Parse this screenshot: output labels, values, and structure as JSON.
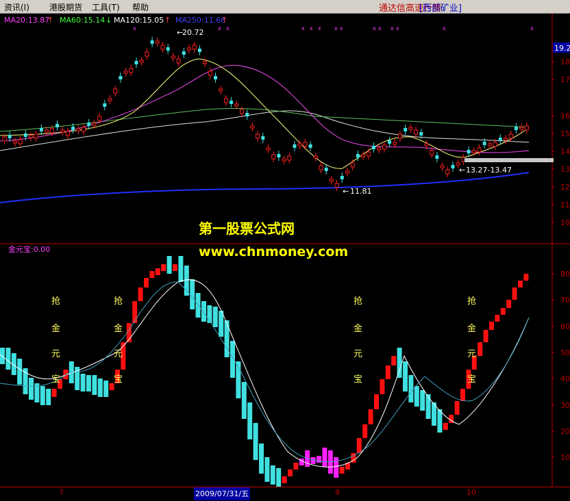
{
  "menu": {
    "items": [
      "资讯(I)",
      "港股期货",
      "工具(T)",
      "帮助"
    ],
    "title": "通达信高速行情",
    "stock": "[西部矿业]"
  },
  "ma_legend": {
    "ma20": "MA20:13.87",
    "ma60": "MA60:15.14",
    "ma120": "MA120:15.05",
    "ma250": "MA250:11.68",
    "colors": {
      "ma20": "#ff40ff",
      "ma60": "#40ff40",
      "ma120": "#ffffff",
      "ma250": "#4040ff"
    }
  },
  "price_panel": {
    "y_ticks": [
      "19.2",
      "18",
      "17",
      "16",
      "15",
      "14",
      "13",
      "12",
      "11",
      "10"
    ],
    "high_label": "20.72",
    "low_label": "11.81",
    "range_label": "13.27-13.47",
    "up_color": "#ff2020",
    "down_color": "#40e0e0"
  },
  "indicator_panel": {
    "title": "金元宝:0.00",
    "y_ticks": [
      "80",
      "70",
      "60",
      "50",
      "40",
      "30",
      "20",
      "10"
    ],
    "signal_chars": [
      "抢",
      "金",
      "元",
      "宝"
    ]
  },
  "watermark": {
    "line1": "第一股票公式网",
    "line2": "www.chnmoney.com"
  },
  "timebar": {
    "ticks": [
      "7",
      "9",
      "10"
    ],
    "date": "2009/07/31/五"
  }
}
